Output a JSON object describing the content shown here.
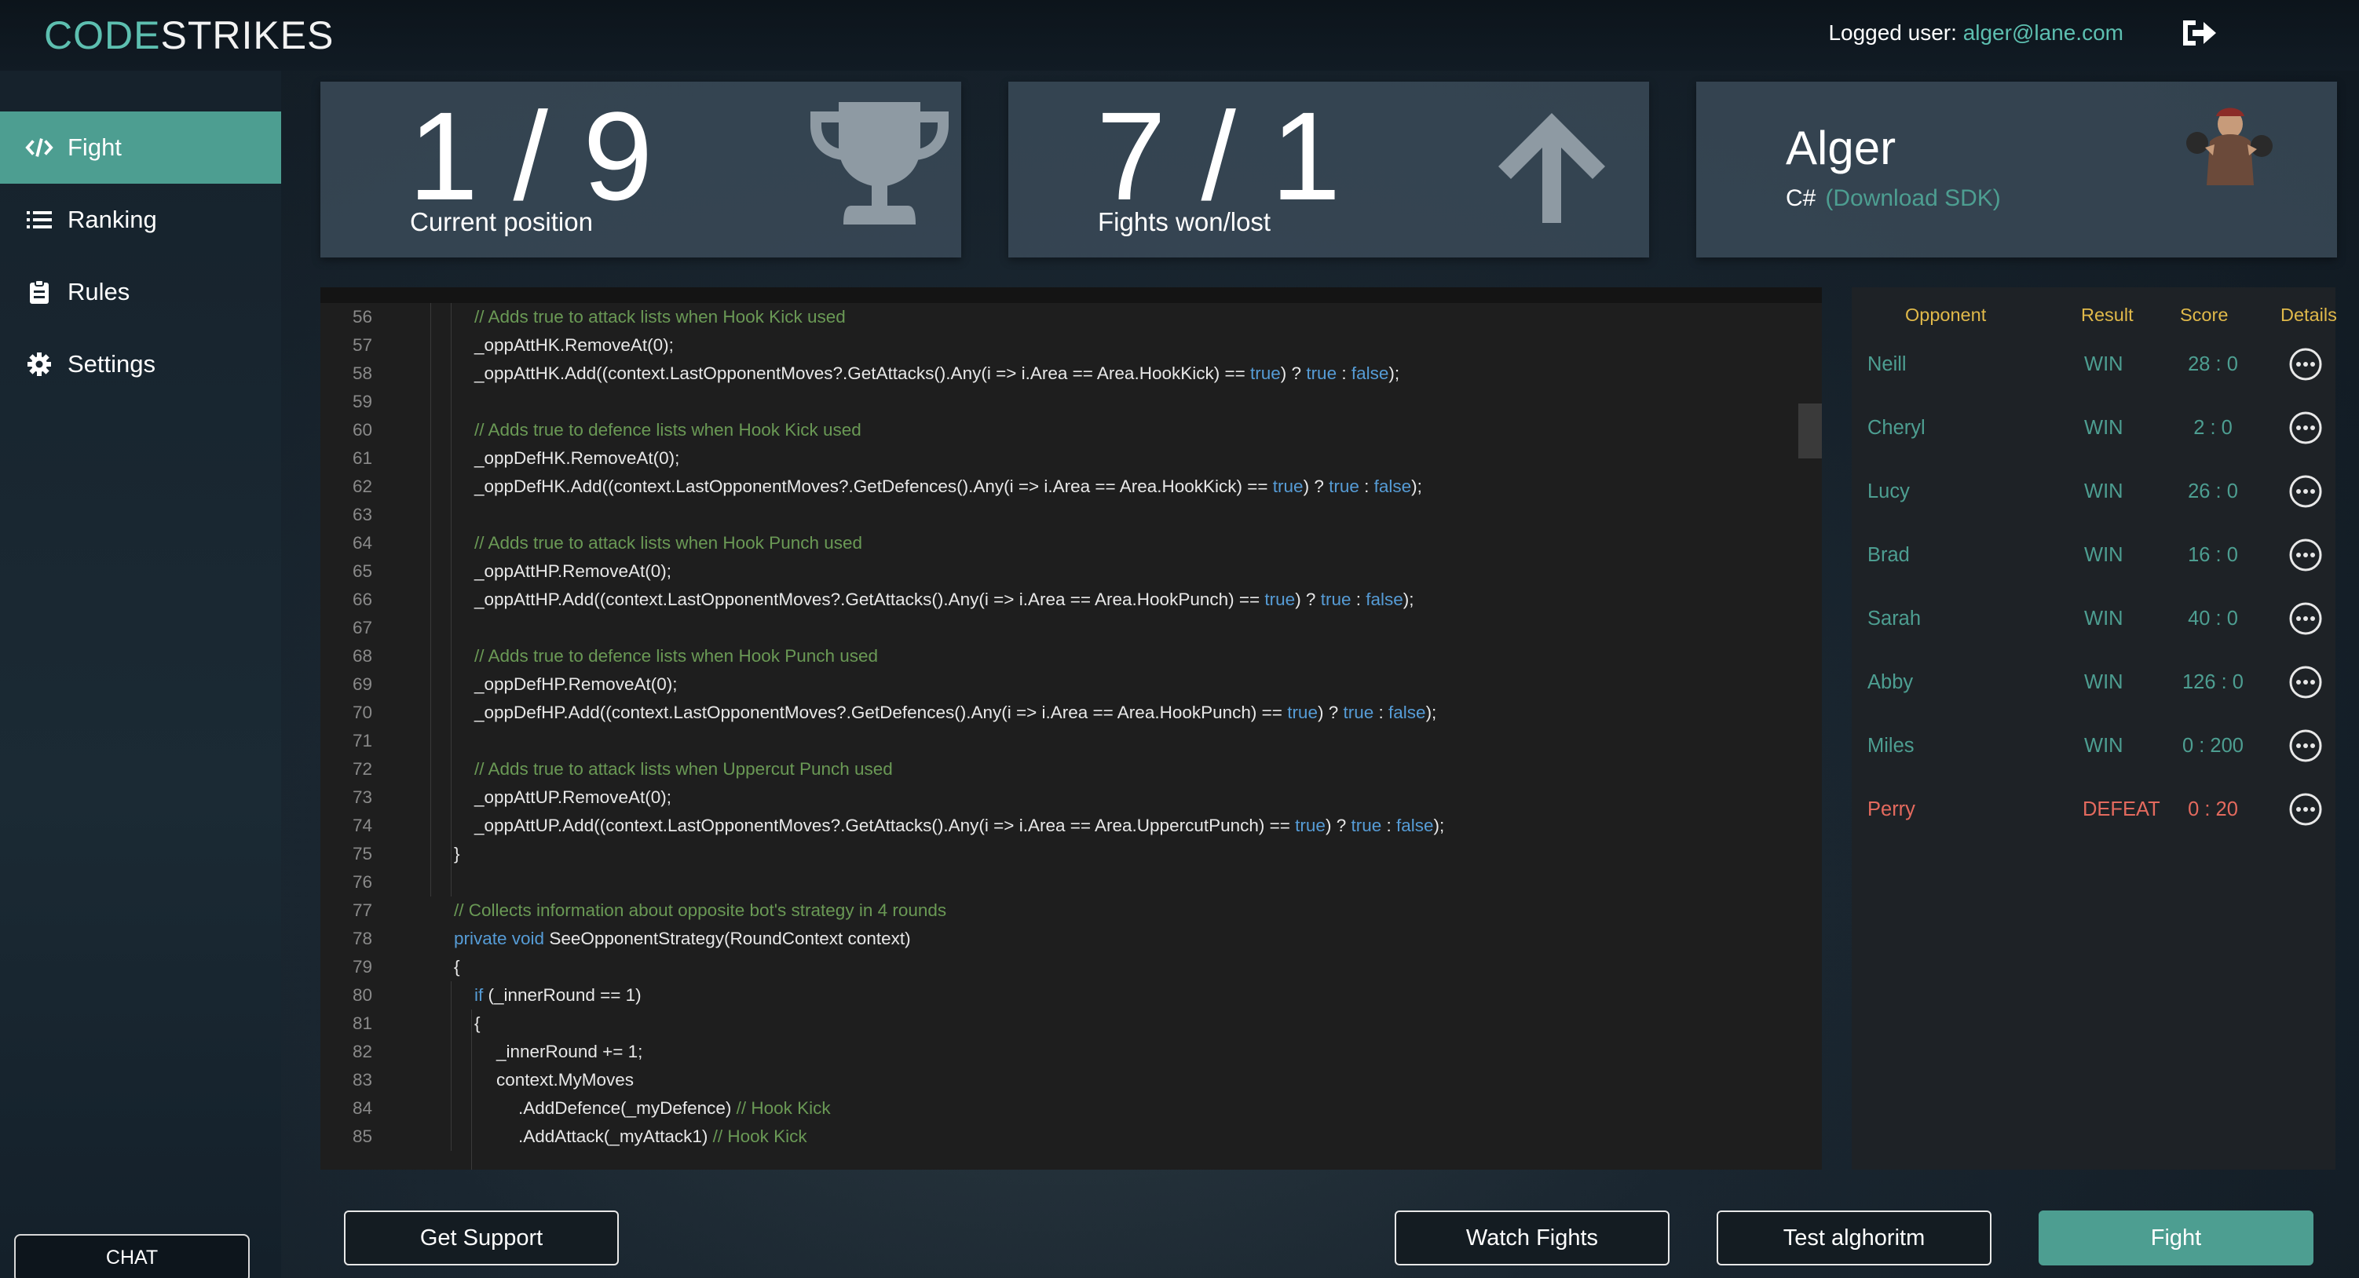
{
  "header": {
    "logo_code": "CODE",
    "logo_strikes": "STRIKES",
    "user_label": "Logged user:",
    "user_email": "alger@lane.com",
    "logout_icon": "logout-icon"
  },
  "sidebar": {
    "items": [
      {
        "label": "Fight",
        "icon": "code-icon",
        "active": true
      },
      {
        "label": "Ranking",
        "icon": "list-icon",
        "active": false
      },
      {
        "label": "Rules",
        "icon": "clipboard-icon",
        "active": false
      },
      {
        "label": "Settings",
        "icon": "gear-icon",
        "active": false
      }
    ],
    "chat_label": "CHAT"
  },
  "stats": {
    "position_value": "1 / 9",
    "position_caption": "Current position",
    "fights_value": "7 / 1",
    "fights_caption": "Fights won/lost",
    "profile_name": "Alger",
    "profile_lang": "C#",
    "profile_sdk": "(Download SDK)"
  },
  "code": {
    "lines": [
      {
        "n": "56",
        "indent": 1,
        "parts": [
          {
            "t": "// Adds true to attack lists when Hook Kick used",
            "c": "comment"
          }
        ]
      },
      {
        "n": "57",
        "indent": 1,
        "parts": [
          {
            "t": "_oppAttHK.RemoveAt(0);",
            "c": ""
          }
        ]
      },
      {
        "n": "58",
        "indent": 1,
        "parts": [
          {
            "t": "_oppAttHK.Add((context.LastOpponentMoves?.GetAttacks().Any(i => i.Area == Area.HookKick) == ",
            "c": ""
          },
          {
            "t": "true",
            "c": "kw"
          },
          {
            "t": ") ? ",
            "c": ""
          },
          {
            "t": "true",
            "c": "kw"
          },
          {
            "t": " : ",
            "c": ""
          },
          {
            "t": "false",
            "c": "kw"
          },
          {
            "t": ");",
            "c": ""
          }
        ]
      },
      {
        "n": "59",
        "indent": 1,
        "parts": []
      },
      {
        "n": "60",
        "indent": 1,
        "parts": [
          {
            "t": "// Adds true to defence lists when Hook Kick used",
            "c": "comment"
          }
        ]
      },
      {
        "n": "61",
        "indent": 1,
        "parts": [
          {
            "t": "_oppDefHK.RemoveAt(0);",
            "c": ""
          }
        ]
      },
      {
        "n": "62",
        "indent": 1,
        "parts": [
          {
            "t": "_oppDefHK.Add((context.LastOpponentMoves?.GetDefences().Any(i => i.Area == Area.HookKick) == ",
            "c": ""
          },
          {
            "t": "true",
            "c": "kw"
          },
          {
            "t": ") ? ",
            "c": ""
          },
          {
            "t": "true",
            "c": "kw"
          },
          {
            "t": " : ",
            "c": ""
          },
          {
            "t": "false",
            "c": "kw"
          },
          {
            "t": ");",
            "c": ""
          }
        ]
      },
      {
        "n": "63",
        "indent": 1,
        "parts": []
      },
      {
        "n": "64",
        "indent": 1,
        "parts": [
          {
            "t": "// Adds true to attack lists when Hook Punch used",
            "c": "comment"
          }
        ]
      },
      {
        "n": "65",
        "indent": 1,
        "parts": [
          {
            "t": "_oppAttHP.RemoveAt(0);",
            "c": ""
          }
        ]
      },
      {
        "n": "66",
        "indent": 1,
        "parts": [
          {
            "t": "_oppAttHP.Add((context.LastOpponentMoves?.GetAttacks().Any(i => i.Area == Area.HookPunch) == ",
            "c": ""
          },
          {
            "t": "true",
            "c": "kw"
          },
          {
            "t": ") ? ",
            "c": ""
          },
          {
            "t": "true",
            "c": "kw"
          },
          {
            "t": " : ",
            "c": ""
          },
          {
            "t": "false",
            "c": "kw"
          },
          {
            "t": ");",
            "c": ""
          }
        ]
      },
      {
        "n": "67",
        "indent": 1,
        "parts": []
      },
      {
        "n": "68",
        "indent": 1,
        "parts": [
          {
            "t": "// Adds true to defence lists when Hook Punch used",
            "c": "comment"
          }
        ]
      },
      {
        "n": "69",
        "indent": 1,
        "parts": [
          {
            "t": "_oppDefHP.RemoveAt(0);",
            "c": ""
          }
        ]
      },
      {
        "n": "70",
        "indent": 1,
        "parts": [
          {
            "t": "_oppDefHP.Add((context.LastOpponentMoves?.GetDefences().Any(i => i.Area == Area.HookPunch) == ",
            "c": ""
          },
          {
            "t": "true",
            "c": "kw"
          },
          {
            "t": ") ? ",
            "c": ""
          },
          {
            "t": "true",
            "c": "kw"
          },
          {
            "t": " : ",
            "c": ""
          },
          {
            "t": "false",
            "c": "kw"
          },
          {
            "t": ");",
            "c": ""
          }
        ]
      },
      {
        "n": "71",
        "indent": 1,
        "parts": []
      },
      {
        "n": "72",
        "indent": 1,
        "parts": [
          {
            "t": "// Adds true to attack lists when Uppercut Punch used",
            "c": "comment"
          }
        ]
      },
      {
        "n": "73",
        "indent": 1,
        "parts": [
          {
            "t": "_oppAttUP.RemoveAt(0);",
            "c": ""
          }
        ]
      },
      {
        "n": "74",
        "indent": 1,
        "parts": [
          {
            "t": "_oppAttUP.Add((context.LastOpponentMoves?.GetAttacks().Any(i => i.Area == Area.UppercutPunch) == ",
            "c": ""
          },
          {
            "t": "true",
            "c": "kw"
          },
          {
            "t": ") ? ",
            "c": ""
          },
          {
            "t": "true",
            "c": "kw"
          },
          {
            "t": " : ",
            "c": ""
          },
          {
            "t": "false",
            "c": "kw"
          },
          {
            "t": ");",
            "c": ""
          }
        ]
      },
      {
        "n": "75",
        "indent": 0,
        "parts": [
          {
            "t": "}",
            "c": ""
          }
        ]
      },
      {
        "n": "76",
        "indent": 0,
        "parts": []
      },
      {
        "n": "77",
        "indent": 0,
        "parts": [
          {
            "t": "// Collects information about opposite bot's strategy in 4 rounds",
            "c": "comment"
          }
        ]
      },
      {
        "n": "78",
        "indent": 0,
        "parts": [
          {
            "t": "private void",
            "c": "kw"
          },
          {
            "t": " SeeOpponentStrategy(RoundContext context)",
            "c": ""
          }
        ]
      },
      {
        "n": "79",
        "indent": 0,
        "parts": [
          {
            "t": "{",
            "c": ""
          }
        ]
      },
      {
        "n": "80",
        "indent": 1,
        "parts": [
          {
            "t": "if",
            "c": "kw"
          },
          {
            "t": " (_innerRound == 1)",
            "c": ""
          }
        ]
      },
      {
        "n": "81",
        "indent": 1,
        "parts": [
          {
            "t": "{",
            "c": ""
          }
        ]
      },
      {
        "n": "82",
        "indent": 2,
        "parts": [
          {
            "t": "_innerRound += 1;",
            "c": ""
          }
        ]
      },
      {
        "n": "83",
        "indent": 2,
        "parts": [
          {
            "t": "context.MyMoves",
            "c": ""
          }
        ]
      },
      {
        "n": "84",
        "indent": 3,
        "parts": [
          {
            "t": ".AddDefence(_myDefence) ",
            "c": ""
          },
          {
            "t": "// Hook Kick",
            "c": "comment"
          }
        ]
      },
      {
        "n": "85",
        "indent": 3,
        "parts": [
          {
            "t": ".AddAttack(_myAttack1) ",
            "c": ""
          },
          {
            "t": "// Hook Kick",
            "c": "comment"
          }
        ]
      }
    ]
  },
  "results": {
    "headers": {
      "opponent": "Opponent",
      "result": "Result",
      "score": "Score",
      "details": "Details"
    },
    "rows": [
      {
        "opponent": "Neill",
        "result": "WIN",
        "score": "28 : 0"
      },
      {
        "opponent": "Cheryl",
        "result": "WIN",
        "score": "2 : 0"
      },
      {
        "opponent": "Lucy",
        "result": "WIN",
        "score": "26 : 0"
      },
      {
        "opponent": "Brad",
        "result": "WIN",
        "score": "16 : 0"
      },
      {
        "opponent": "Sarah",
        "result": "WIN",
        "score": "40 : 0"
      },
      {
        "opponent": "Abby",
        "result": "WIN",
        "score": "126 : 0"
      },
      {
        "opponent": "Miles",
        "result": "WIN",
        "score": "0 : 200"
      },
      {
        "opponent": "Perry",
        "result": "DEFEAT",
        "score": "0 : 20"
      }
    ]
  },
  "actions": {
    "support": "Get Support",
    "watch": "Watch Fights",
    "test": "Test alghoritm",
    "fight": "Fight"
  },
  "colors": {
    "accent": "#4d9e91",
    "win": "#4d9e91",
    "defeat": "#e46a5e",
    "header_text": "#e0b94a"
  }
}
